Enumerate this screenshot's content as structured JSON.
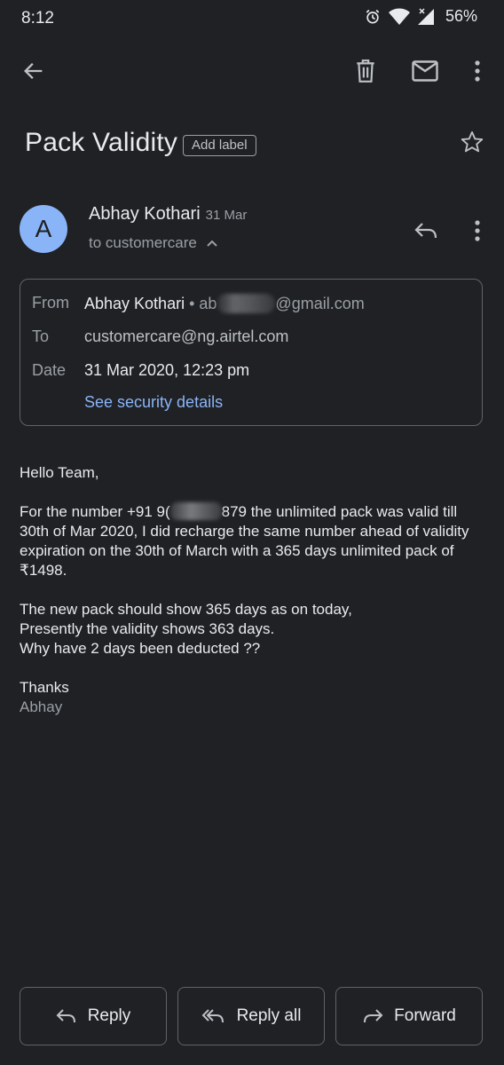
{
  "status_bar": {
    "time": "8:12",
    "battery": "56%",
    "icons": [
      "alarm-icon",
      "wifi-icon",
      "signal-icon"
    ]
  },
  "toolbar": {
    "icons": [
      "back-arrow-icon",
      "trash-icon",
      "mail-icon",
      "more-vert-icon"
    ]
  },
  "email": {
    "subject": "Pack Validity",
    "add_label": "Add label",
    "sender_initial": "A",
    "sender_name": "Abhay Kothari",
    "date_short": "31 Mar",
    "to_summary": "to customercare",
    "details": {
      "from_label": "From",
      "from_name": "Abhay Kothari",
      "from_sep": " • ",
      "from_email_start": "ab",
      "from_email_end": "@gmail.com",
      "to_label": "To",
      "to_value": "customercare@ng.airtel.com",
      "date_label": "Date",
      "date_value": "31 Mar 2020, 12:23 pm",
      "security_link": "See security details"
    },
    "body": {
      "greeting": "Hello Team,",
      "p1_start": "For the number +91 9(",
      "p1_end": "879 the unlimited pack was valid till 30th of Mar 2020, I did recharge the same number ahead of validity expiration on the 30th of March with a 365 days unlimited pack of ₹1498.",
      "p2_line1": "The new pack should show 365 days as on today,",
      "p2_line2": "Presently the validity shows 363 days.",
      "p2_line3": "Why have 2 days been deducted ??",
      "thanks": "Thanks",
      "signature": "Abhay"
    }
  },
  "actions": {
    "reply": "Reply",
    "reply_all": "Reply all",
    "forward": "Forward"
  },
  "colors": {
    "background": "#202124",
    "text": "#e8eaed",
    "secondary_text": "#9aa0a6",
    "link": "#8ab4f8",
    "avatar": "#8ab4f8",
    "border": "#5f6368"
  }
}
